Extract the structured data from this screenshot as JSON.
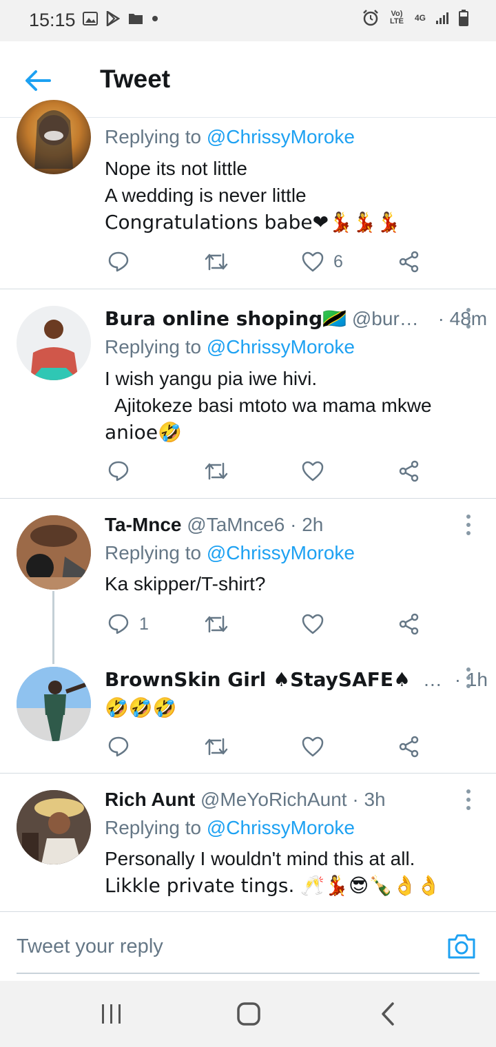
{
  "status_bar": {
    "time": "15:15",
    "left_icons": [
      "image-icon",
      "play-store-icon",
      "folder-icon",
      "dot-icon"
    ],
    "right_icons": [
      "alarm-icon",
      "volte-icon",
      "4g-icon",
      "signal-icon",
      "battery-icon"
    ],
    "volte_label": "Vo) LTE",
    "network_label": "4G"
  },
  "app_bar": {
    "title": "Tweet"
  },
  "tweets": [
    {
      "reply_label": "Replying to",
      "reply_handle": "@ChrissyMoroke",
      "body_lines": [
        "Nope its not little",
        "A wedding is never little",
        "Congratulations babe❤💃💃💃"
      ],
      "reply_count": "",
      "retweet_count": "",
      "like_count": "6"
    },
    {
      "name": "Bura online shoping🇹🇿",
      "handle": "@bur…",
      "time": "· 48m",
      "reply_label": "Replying to",
      "reply_handle": "@ChrissyMoroke",
      "body_lines": [
        "I wish yangu pia iwe hivi.",
        "  Ajitokeze basi mtoto wa mama mkwe",
        "anioe🤣"
      ],
      "reply_count": "",
      "like_count": ""
    },
    {
      "name": "Ta-Mnce",
      "handle": "@TaMnce6",
      "time": "· 2h",
      "reply_label": "Replying to",
      "reply_handle": "@ChrissyMoroke",
      "body_lines": [
        "Ka skipper/T-shirt?"
      ],
      "reply_count": "1",
      "like_count": ""
    },
    {
      "name": "BrownSkin Girl ♠StaySAFE♠",
      "handle": "…",
      "time": "· 1h",
      "body_lines": [
        "🤣🤣🤣"
      ],
      "reply_count": "",
      "like_count": ""
    },
    {
      "name": "Rich Aunt",
      "handle": "@MeYoRichAunt",
      "time": "· 3h",
      "reply_label": "Replying to",
      "reply_handle": "@ChrissyMoroke",
      "body_lines": [
        "Personally I wouldn't mind this at all.",
        "Likkle private tings. 🥂💃😎🍾👌👌"
      ]
    }
  ],
  "reply_box": {
    "placeholder": "Tweet your reply"
  },
  "nav_bar": {
    "buttons": [
      "recents-icon",
      "home-icon",
      "back-icon"
    ]
  },
  "colors": {
    "accent": "#1da1f2",
    "muted": "#657786",
    "text": "#14171a",
    "divider": "#d4dbe0"
  }
}
